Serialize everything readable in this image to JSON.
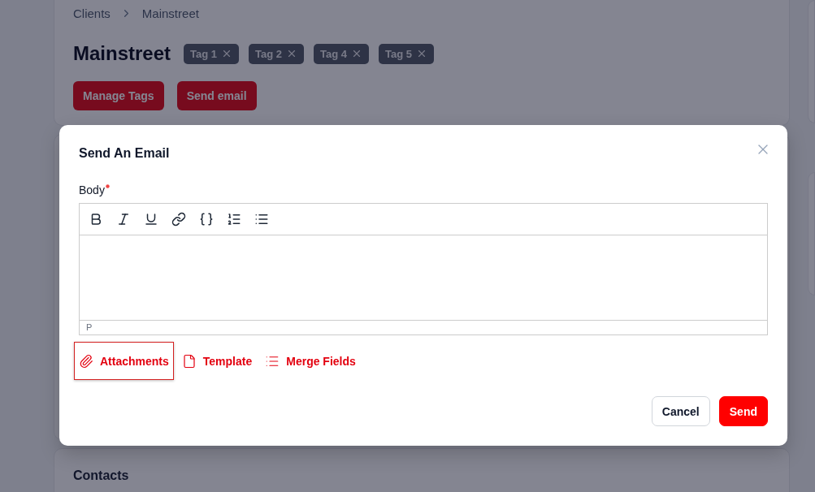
{
  "breadcrumb": [
    {
      "label": "Clients"
    },
    {
      "label": "Mainstreet"
    }
  ],
  "page": {
    "title": "Mainstreet",
    "tags": [
      {
        "label": "Tag 1"
      },
      {
        "label": "Tag 2"
      },
      {
        "label": "Tag 4"
      },
      {
        "label": "Tag 5"
      }
    ],
    "buttons": [
      "Manage Tags",
      "Send email"
    ]
  },
  "contacts": {
    "title": "Contacts"
  },
  "dialog": {
    "title": "Send An Email",
    "body_label": "Body",
    "required": true,
    "editor": {
      "toolbar": [
        {
          "kind": "bold"
        },
        {
          "kind": "italic"
        },
        {
          "kind": "underline"
        },
        {
          "kind": "link"
        },
        {
          "kind": "braces"
        },
        {
          "kind": "ordered"
        },
        {
          "kind": "bullets"
        }
      ],
      "status": "P"
    },
    "actions": [
      {
        "kind": "attach",
        "label": "Attachments",
        "focused": true
      },
      {
        "kind": "template",
        "label": "Template",
        "focused": false
      },
      {
        "kind": "fields",
        "label": "Merge Fields",
        "focused": false
      }
    ],
    "buttons": [
      {
        "kind": "secondary",
        "label": "Cancel"
      },
      {
        "kind": "primary",
        "label": "Send"
      }
    ]
  }
}
